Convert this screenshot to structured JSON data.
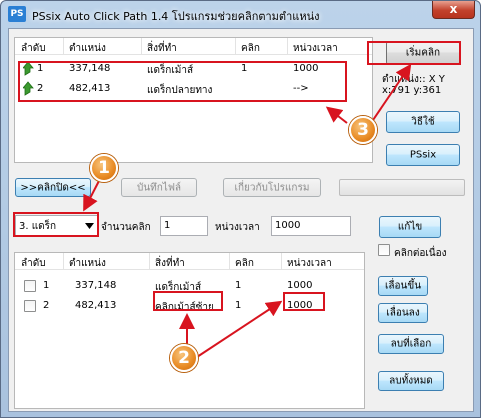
{
  "window": {
    "title": "PSsix Auto Click Path 1.4 โปรแกรมช่วยคลิกตามตำแหน่ง",
    "icon_text": "PS",
    "close_glyph": "x"
  },
  "top_list": {
    "headers": [
      "ลำดับ",
      "ตำแหน่ง",
      "สิ่งที่ทำ",
      "คลิก",
      "หน่วงเวลา"
    ],
    "rows": [
      {
        "order": "1",
        "position": "337,148",
        "action": "แดร็กเม้าส์",
        "clicks": "1",
        "delay": "1000"
      },
      {
        "order": "2",
        "position": "482,413",
        "action": "แดร็กปลายทาง",
        "clicks": "",
        "delay": "-->"
      }
    ]
  },
  "right_panel": {
    "start_button": "เริ่มคลิก",
    "position_label": "ตำแหน่ง:: X Y",
    "position_value": "x:791 y:361",
    "howto_button": "วิธีใช้",
    "pssix_button": "PSsix"
  },
  "toolbar": {
    "toggle_button": ">>คลิกปิด<<",
    "save_button": "บันทึกไฟล์",
    "about_button": "เกี่ยวกับโปรแกรม",
    "progress": 0
  },
  "controls": {
    "action_select": "3. แดร็ก",
    "click_count_label": "จำนวนคลิก",
    "click_count_value": "1",
    "delay_label": "หน่วงเวลา",
    "delay_value": "1000",
    "edit_button": "แก้ไข",
    "continuous_label": "คลิกต่อเนื่อง",
    "continuous_checked": false
  },
  "bottom_list": {
    "headers": [
      "ลำดับ",
      "ตำแหน่ง",
      "สิ่งที่ทำ",
      "คลิก",
      "หน่วงเวลา"
    ],
    "rows": [
      {
        "order": "1",
        "position": "337,148",
        "action": "แดร็กเม้าส์",
        "clicks": "1",
        "delay": "1000"
      },
      {
        "order": "2",
        "position": "482,413",
        "action": "คลิกเม้าส์ซ้าย",
        "clicks": "1",
        "delay": "1000"
      }
    ]
  },
  "side_buttons": {
    "move_up": "เลื่อนขึ้น",
    "move_down": "เลื่อนลง",
    "delete_selected": "ลบที่เลือก",
    "delete_all": "ลบทั้งหมด"
  },
  "annotations": {
    "badge1": "1",
    "badge2": "2",
    "badge3": "3",
    "highlight_color": "#d8141f",
    "badge_color": "#e88a23"
  },
  "icons": {
    "row_icon": "green-up-arrow-icon",
    "select_icon": "chevron-down-icon"
  }
}
